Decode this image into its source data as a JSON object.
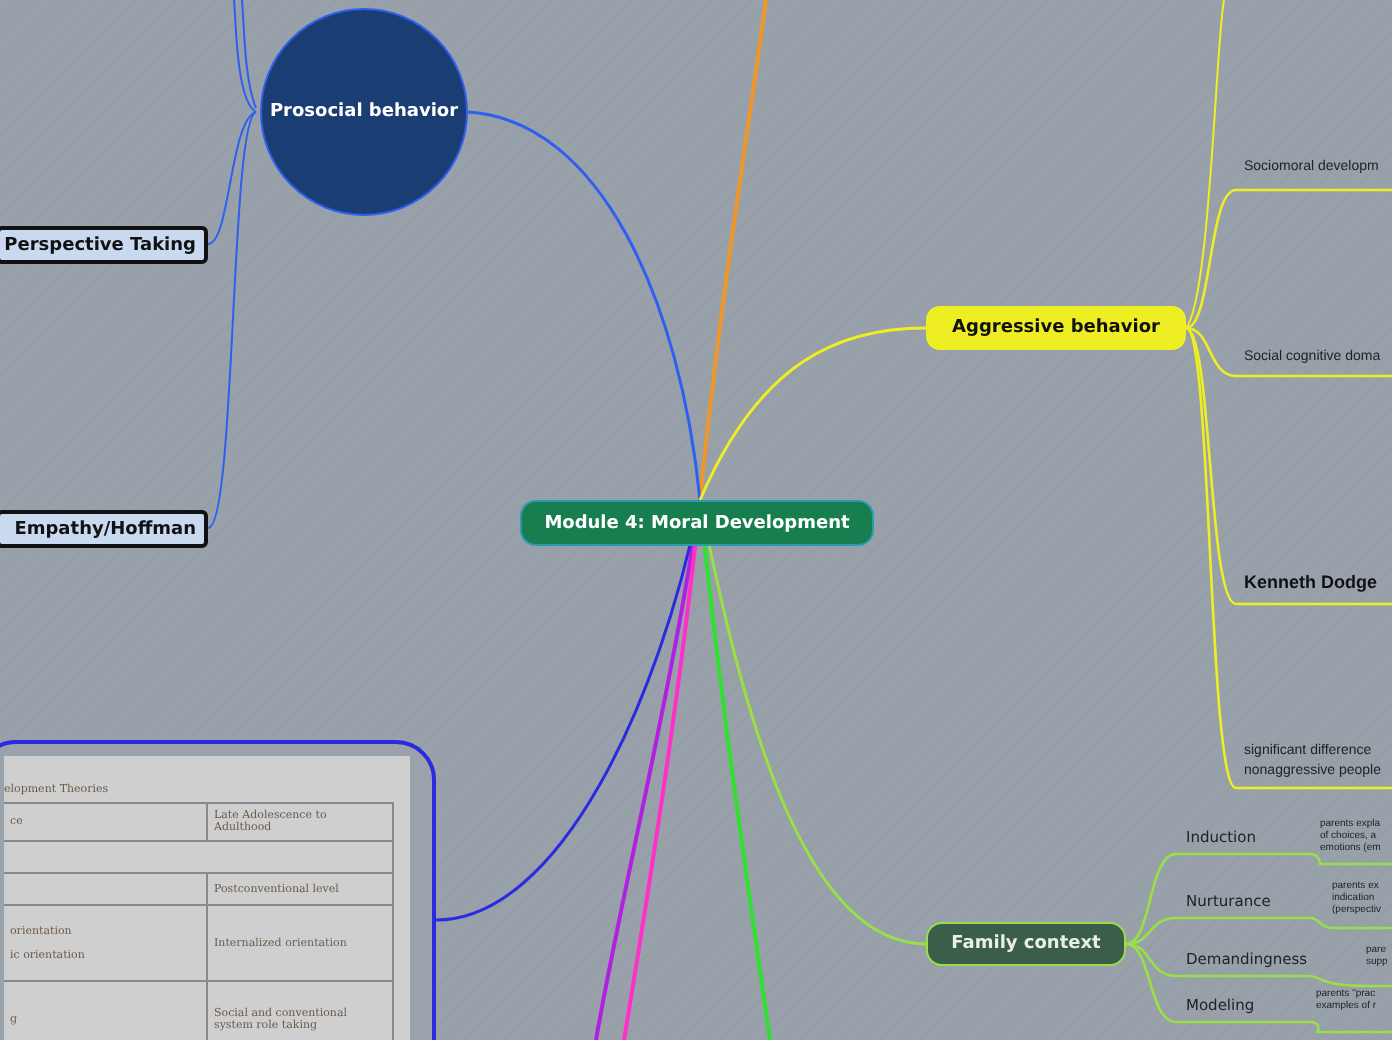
{
  "central": {
    "label": "Module 4: Moral Development"
  },
  "prosocial": {
    "label": "Prosocial behavior",
    "color": "#2e5ff0",
    "children": [
      {
        "label": "Perspective Taking"
      },
      {
        "label": "Empathy/Hoffman"
      }
    ]
  },
  "aggressive": {
    "label": "Aggressive behavior",
    "color": "#eeee22",
    "notes": [
      {
        "lines": [
          "Sociomoral developm"
        ],
        "bold": false
      },
      {
        "lines": [
          "Social cognitive doma"
        ],
        "bold": false
      },
      {
        "lines": [
          "Kenneth Dodge"
        ],
        "bold": true
      },
      {
        "lines": [
          "significant difference",
          "nonaggressive people"
        ],
        "bold": false
      }
    ]
  },
  "family": {
    "label": "Family context",
    "color": "#99e044",
    "children": [
      {
        "label": "Induction",
        "details": [
          "parents expla",
          "of choices, a",
          "emotions (em"
        ]
      },
      {
        "label": "Nurturance",
        "details": [
          "parents ex",
          "indication",
          "(perspectiv"
        ]
      },
      {
        "label": "Demandingness",
        "details": [
          "pare",
          "supp"
        ]
      },
      {
        "label": "Modeling",
        "details": [
          "parents \"prac",
          "examples of r"
        ]
      }
    ]
  },
  "theories_table": {
    "color": "#2a2ae0",
    "title": "elopment Theories",
    "rows": [
      {
        "left": [
          "ce"
        ],
        "right": "Late Adolescence to Adulthood"
      },
      {
        "left": [],
        "right": "Postconventional level"
      },
      {
        "left": [
          "orientation",
          "ic orientation"
        ],
        "right": "Internalized orientation"
      },
      {
        "left": [
          "g"
        ],
        "right": "Social and conventional system role taking"
      }
    ]
  },
  "offscreen_branches": [
    {
      "color": "#f0952a"
    },
    {
      "color": "#b020e0"
    },
    {
      "color": "#ff30c8"
    },
    {
      "color": "#30e030"
    }
  ]
}
